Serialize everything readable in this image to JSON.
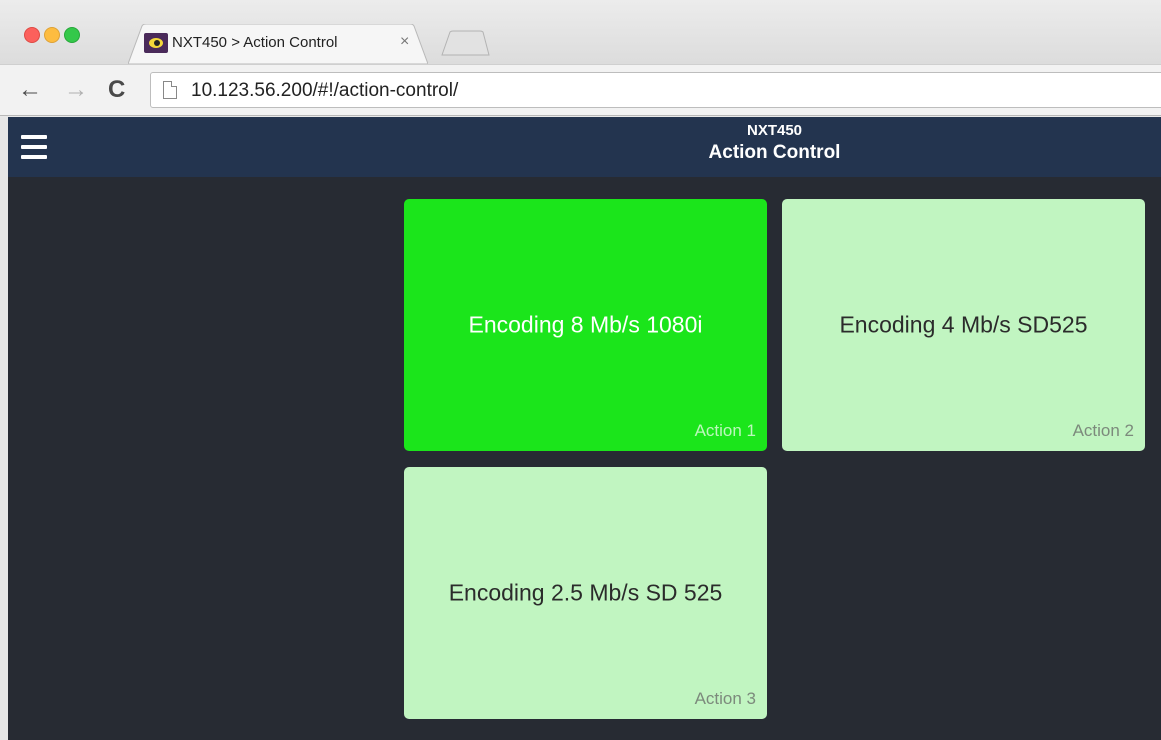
{
  "browser": {
    "tab_title": "NXT450 > Action Control",
    "tab_close": "×",
    "url": "10.123.56.200/#!/action-control/",
    "icons": {
      "back": "arrow-left-icon",
      "forward": "arrow-right-icon",
      "reload": "reload-icon",
      "page": "page-icon"
    },
    "nav_glyphs": {
      "back": "←",
      "forward": "→",
      "reload": "C"
    }
  },
  "header": {
    "device": "NXT450",
    "title": "Action Control",
    "background": "#23344f"
  },
  "tiles": [
    {
      "label": "Encoding 8 Mb/s 1080i",
      "action": "Action 1",
      "state": "active",
      "color": "#1be51b"
    },
    {
      "label": "Encoding 4 Mb/s SD525",
      "action": "Action 2",
      "state": "inactive",
      "color": "#c1f5c1"
    },
    {
      "label": "Encoding 2.5 Mb/s SD 525",
      "action": "Action 3",
      "state": "inactive",
      "color": "#c1f5c1"
    }
  ],
  "colors": {
    "content_bg": "#272b33"
  }
}
